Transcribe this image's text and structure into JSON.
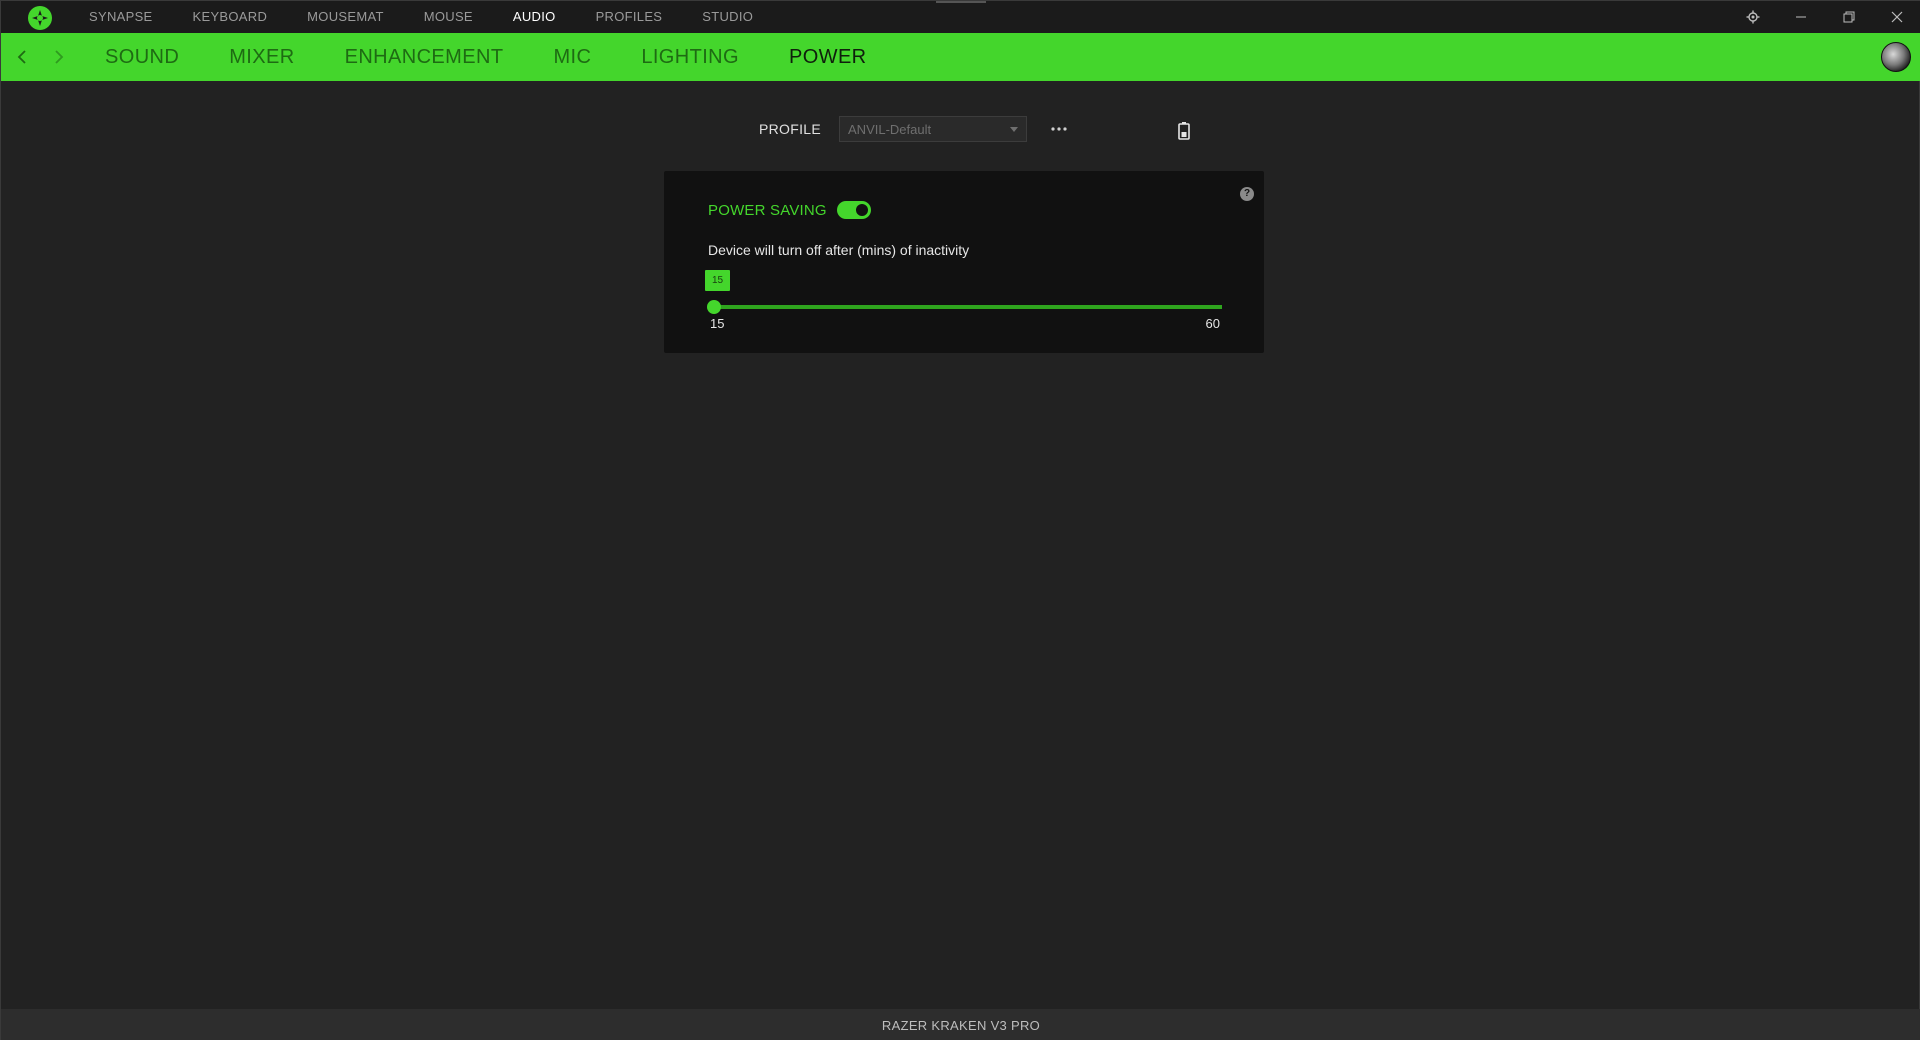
{
  "topnav": {
    "items": [
      "SYNAPSE",
      "KEYBOARD",
      "MOUSEMAT",
      "MOUSE",
      "AUDIO",
      "PROFILES",
      "STUDIO"
    ],
    "active": "AUDIO"
  },
  "subnav": {
    "tabs": [
      "SOUND",
      "MIXER",
      "ENHANCEMENT",
      "MIC",
      "LIGHTING",
      "POWER"
    ],
    "active": "POWER"
  },
  "profile": {
    "label": "PROFILE",
    "selected": "ANVIL-Default"
  },
  "power": {
    "label": "POWER SAVING",
    "enabled": true,
    "description": "Device will turn off after (mins) of inactivity",
    "value": "15",
    "min": "15",
    "max": "60"
  },
  "footer": {
    "device_name": "RAZER KRAKEN V3 PRO"
  },
  "colors": {
    "accent": "#44d62c",
    "background": "#222222",
    "card": "#111111"
  },
  "icons": [
    "razer-logo-icon",
    "settings-icon",
    "minimize-icon",
    "restore-icon",
    "close-icon",
    "back-arrow-icon",
    "forward-arrow-icon",
    "more-icon",
    "battery-icon",
    "help-icon"
  ]
}
